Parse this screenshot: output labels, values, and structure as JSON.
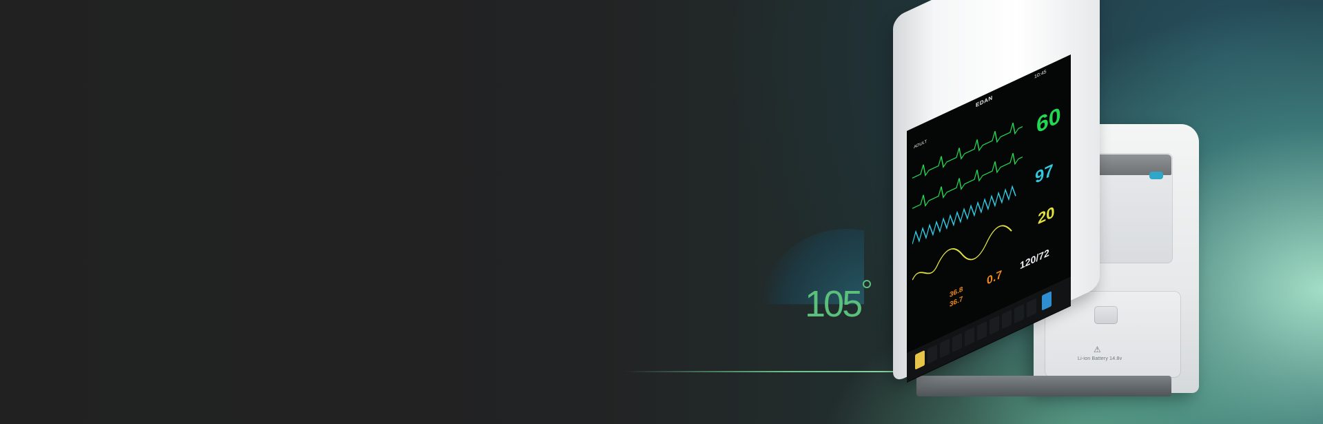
{
  "callout": {
    "angle_value": "105"
  },
  "monitor": {
    "brand": "EDAN",
    "time": "10:45",
    "mode": "ADULT",
    "heart_rate": "60",
    "spo2": "97",
    "resp_rate": "20",
    "temp_1": "36.8",
    "temp_2": "36.7",
    "temp_delta": "0.7",
    "nibp": "120/72",
    "battery_label": "Li-ion Battery 14.8v",
    "warning_symbol": "⚠"
  },
  "colors": {
    "ecg": "#23d851",
    "spo2": "#31c9df",
    "resp": "#e4e23d",
    "temp": "#f08b18",
    "angle_text": "#5cc07d"
  }
}
